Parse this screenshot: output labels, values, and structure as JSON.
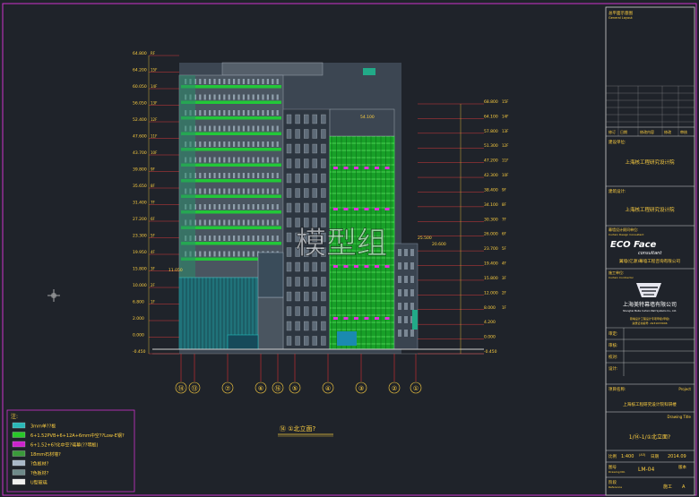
{
  "drawing": {
    "watermark": "模型组",
    "view_title": "⑭ ①北立面?",
    "levels_left": {
      "elev": [
        "64.800",
        "64.200",
        "60.050",
        "56.050",
        "52.400",
        "47.600",
        "43.700",
        "39.800",
        "35.650",
        "31.400",
        "27.200",
        "23.300",
        "19.950",
        "15.800",
        "10.000",
        "6.800",
        "2.000",
        "0.000",
        "-0.450"
      ],
      "floor": [
        "RF",
        "15F",
        "14F",
        "13F",
        "12F",
        "11F",
        "10F",
        "9F",
        "8F",
        "7F",
        "6F",
        "5F",
        "4F",
        "3F",
        "2F",
        "1F"
      ]
    },
    "levels_right": {
      "elev": [
        "68.800",
        "64.100",
        "57.800",
        "51.300",
        "47.200",
        "42.300",
        "38.400",
        "34.100",
        "30.300",
        "26.000",
        "23.700",
        "19.400",
        "15.800",
        "12.000",
        "8.000",
        "4.200",
        "0.000",
        "-0.450"
      ],
      "floor": [
        "15F",
        "14F",
        "13F",
        "12F",
        "11F",
        "10F",
        "9F",
        "8F",
        "7F",
        "6F",
        "5F",
        "4F",
        "3F",
        "2F",
        "1F"
      ]
    },
    "top_annot": "54.100",
    "annex_annot_1": "25.500",
    "annex_annot_2": "20.600",
    "annex_annot_3": "11.050",
    "grid_axes": [
      "⑭",
      "⑬",
      "⑦",
      "⑥",
      "⑯",
      "⑤",
      "④",
      "③",
      "②",
      "①"
    ]
  },
  "legend": {
    "title": "注:",
    "items": [
      {
        "text": "3mm单??板",
        "color": "#2ab8b8"
      },
      {
        "text": "6+1.52PVB+6+12A+6mm中空??Low-E钢?",
        "color": "#28c828"
      },
      {
        "text": "6+1.52+6?化中空?璃幕(??明板)",
        "color": "#cc22cc"
      },
      {
        "text": "18mm石材墙?",
        "color": "#3a9a3a"
      },
      {
        "text": "?色板材?",
        "color": "#a9b8c8"
      },
      {
        "text": "?色板材?",
        "color": "#6e8a8a"
      },
      {
        "text": "U型玻璃",
        "color": "#f0f0f0"
      }
    ]
  },
  "title_block": {
    "header_label": "总平面示意图",
    "header_sub": "General Layout",
    "rev_headers": [
      "修订",
      "日期",
      "修改内容",
      "修改",
      "审核"
    ],
    "client_label": "建设单位:",
    "client": "上海核工程研究设计院",
    "architect_label": "建筑设计:",
    "architect": "上海核工程研究设计院",
    "consultant_label": "幕墙设计顾问单位:",
    "consultant_sub": "Curtain Design Consultant",
    "logo_main": "ECO Face",
    "logo_sub": "consultant",
    "consultant": "翼墙(亿源)幕墙工程咨询有限公司",
    "contractor_label": "施工单位:",
    "contractor_sub": "Curtain Contractor",
    "contractor_name": "上海美特幕墙有限公司",
    "contractor_en": "Shanghai Meite Curtain Wall Systems Co., Ltd.",
    "contractor_qual_1": "幕墙设计工程设计专项甲级(甲级)",
    "contractor_qual_2": "资质证书编号: A931033046",
    "approved": "审定:",
    "reviewed": "审核:",
    "checked": "校对:",
    "designed": "设计:",
    "project_label": "项目名称:",
    "project_en": "Project",
    "project": "上海核工程研究设计院科研楼",
    "drawing_title_en": "Drawing Title",
    "drawing_title": "1/⑭-1/①北立面?",
    "scale_label": "比例",
    "scale": "1:400",
    "paper": "(A3)",
    "date_label": "日期",
    "date": "2014.09",
    "drawing_no_label": "图号",
    "drawing_no_sub": "Drawing NO.",
    "drawing_no": "LM-04",
    "version_label": "版本",
    "stage_label": "阶段",
    "stage_sub": "Reference",
    "stage": "施工",
    "version": "A"
  }
}
